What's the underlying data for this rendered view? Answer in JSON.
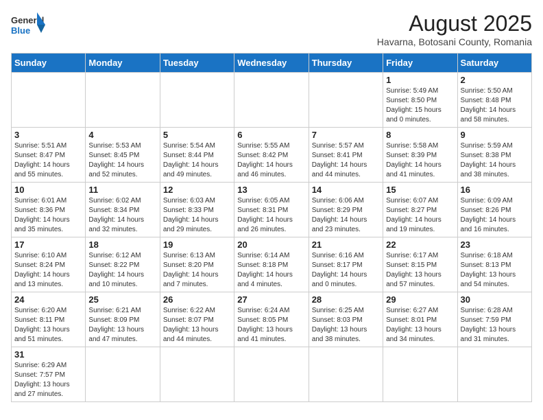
{
  "header": {
    "logo_general": "General",
    "logo_blue": "Blue",
    "month_year": "August 2025",
    "location": "Havarna, Botosani County, Romania"
  },
  "weekdays": [
    "Sunday",
    "Monday",
    "Tuesday",
    "Wednesday",
    "Thursday",
    "Friday",
    "Saturday"
  ],
  "weeks": [
    [
      {
        "date": "",
        "info": ""
      },
      {
        "date": "",
        "info": ""
      },
      {
        "date": "",
        "info": ""
      },
      {
        "date": "",
        "info": ""
      },
      {
        "date": "",
        "info": ""
      },
      {
        "date": "1",
        "info": "Sunrise: 5:49 AM\nSunset: 8:50 PM\nDaylight: 15 hours and 0 minutes."
      },
      {
        "date": "2",
        "info": "Sunrise: 5:50 AM\nSunset: 8:48 PM\nDaylight: 14 hours and 58 minutes."
      }
    ],
    [
      {
        "date": "3",
        "info": "Sunrise: 5:51 AM\nSunset: 8:47 PM\nDaylight: 14 hours and 55 minutes."
      },
      {
        "date": "4",
        "info": "Sunrise: 5:53 AM\nSunset: 8:45 PM\nDaylight: 14 hours and 52 minutes."
      },
      {
        "date": "5",
        "info": "Sunrise: 5:54 AM\nSunset: 8:44 PM\nDaylight: 14 hours and 49 minutes."
      },
      {
        "date": "6",
        "info": "Sunrise: 5:55 AM\nSunset: 8:42 PM\nDaylight: 14 hours and 46 minutes."
      },
      {
        "date": "7",
        "info": "Sunrise: 5:57 AM\nSunset: 8:41 PM\nDaylight: 14 hours and 44 minutes."
      },
      {
        "date": "8",
        "info": "Sunrise: 5:58 AM\nSunset: 8:39 PM\nDaylight: 14 hours and 41 minutes."
      },
      {
        "date": "9",
        "info": "Sunrise: 5:59 AM\nSunset: 8:38 PM\nDaylight: 14 hours and 38 minutes."
      }
    ],
    [
      {
        "date": "10",
        "info": "Sunrise: 6:01 AM\nSunset: 8:36 PM\nDaylight: 14 hours and 35 minutes."
      },
      {
        "date": "11",
        "info": "Sunrise: 6:02 AM\nSunset: 8:34 PM\nDaylight: 14 hours and 32 minutes."
      },
      {
        "date": "12",
        "info": "Sunrise: 6:03 AM\nSunset: 8:33 PM\nDaylight: 14 hours and 29 minutes."
      },
      {
        "date": "13",
        "info": "Sunrise: 6:05 AM\nSunset: 8:31 PM\nDaylight: 14 hours and 26 minutes."
      },
      {
        "date": "14",
        "info": "Sunrise: 6:06 AM\nSunset: 8:29 PM\nDaylight: 14 hours and 23 minutes."
      },
      {
        "date": "15",
        "info": "Sunrise: 6:07 AM\nSunset: 8:27 PM\nDaylight: 14 hours and 19 minutes."
      },
      {
        "date": "16",
        "info": "Sunrise: 6:09 AM\nSunset: 8:26 PM\nDaylight: 14 hours and 16 minutes."
      }
    ],
    [
      {
        "date": "17",
        "info": "Sunrise: 6:10 AM\nSunset: 8:24 PM\nDaylight: 14 hours and 13 minutes."
      },
      {
        "date": "18",
        "info": "Sunrise: 6:12 AM\nSunset: 8:22 PM\nDaylight: 14 hours and 10 minutes."
      },
      {
        "date": "19",
        "info": "Sunrise: 6:13 AM\nSunset: 8:20 PM\nDaylight: 14 hours and 7 minutes."
      },
      {
        "date": "20",
        "info": "Sunrise: 6:14 AM\nSunset: 8:18 PM\nDaylight: 14 hours and 4 minutes."
      },
      {
        "date": "21",
        "info": "Sunrise: 6:16 AM\nSunset: 8:17 PM\nDaylight: 14 hours and 0 minutes."
      },
      {
        "date": "22",
        "info": "Sunrise: 6:17 AM\nSunset: 8:15 PM\nDaylight: 13 hours and 57 minutes."
      },
      {
        "date": "23",
        "info": "Sunrise: 6:18 AM\nSunset: 8:13 PM\nDaylight: 13 hours and 54 minutes."
      }
    ],
    [
      {
        "date": "24",
        "info": "Sunrise: 6:20 AM\nSunset: 8:11 PM\nDaylight: 13 hours and 51 minutes."
      },
      {
        "date": "25",
        "info": "Sunrise: 6:21 AM\nSunset: 8:09 PM\nDaylight: 13 hours and 47 minutes."
      },
      {
        "date": "26",
        "info": "Sunrise: 6:22 AM\nSunset: 8:07 PM\nDaylight: 13 hours and 44 minutes."
      },
      {
        "date": "27",
        "info": "Sunrise: 6:24 AM\nSunset: 8:05 PM\nDaylight: 13 hours and 41 minutes."
      },
      {
        "date": "28",
        "info": "Sunrise: 6:25 AM\nSunset: 8:03 PM\nDaylight: 13 hours and 38 minutes."
      },
      {
        "date": "29",
        "info": "Sunrise: 6:27 AM\nSunset: 8:01 PM\nDaylight: 13 hours and 34 minutes."
      },
      {
        "date": "30",
        "info": "Sunrise: 6:28 AM\nSunset: 7:59 PM\nDaylight: 13 hours and 31 minutes."
      }
    ],
    [
      {
        "date": "31",
        "info": "Sunrise: 6:29 AM\nSunset: 7:57 PM\nDaylight: 13 hours and 27 minutes."
      },
      {
        "date": "",
        "info": ""
      },
      {
        "date": "",
        "info": ""
      },
      {
        "date": "",
        "info": ""
      },
      {
        "date": "",
        "info": ""
      },
      {
        "date": "",
        "info": ""
      },
      {
        "date": "",
        "info": ""
      }
    ]
  ]
}
